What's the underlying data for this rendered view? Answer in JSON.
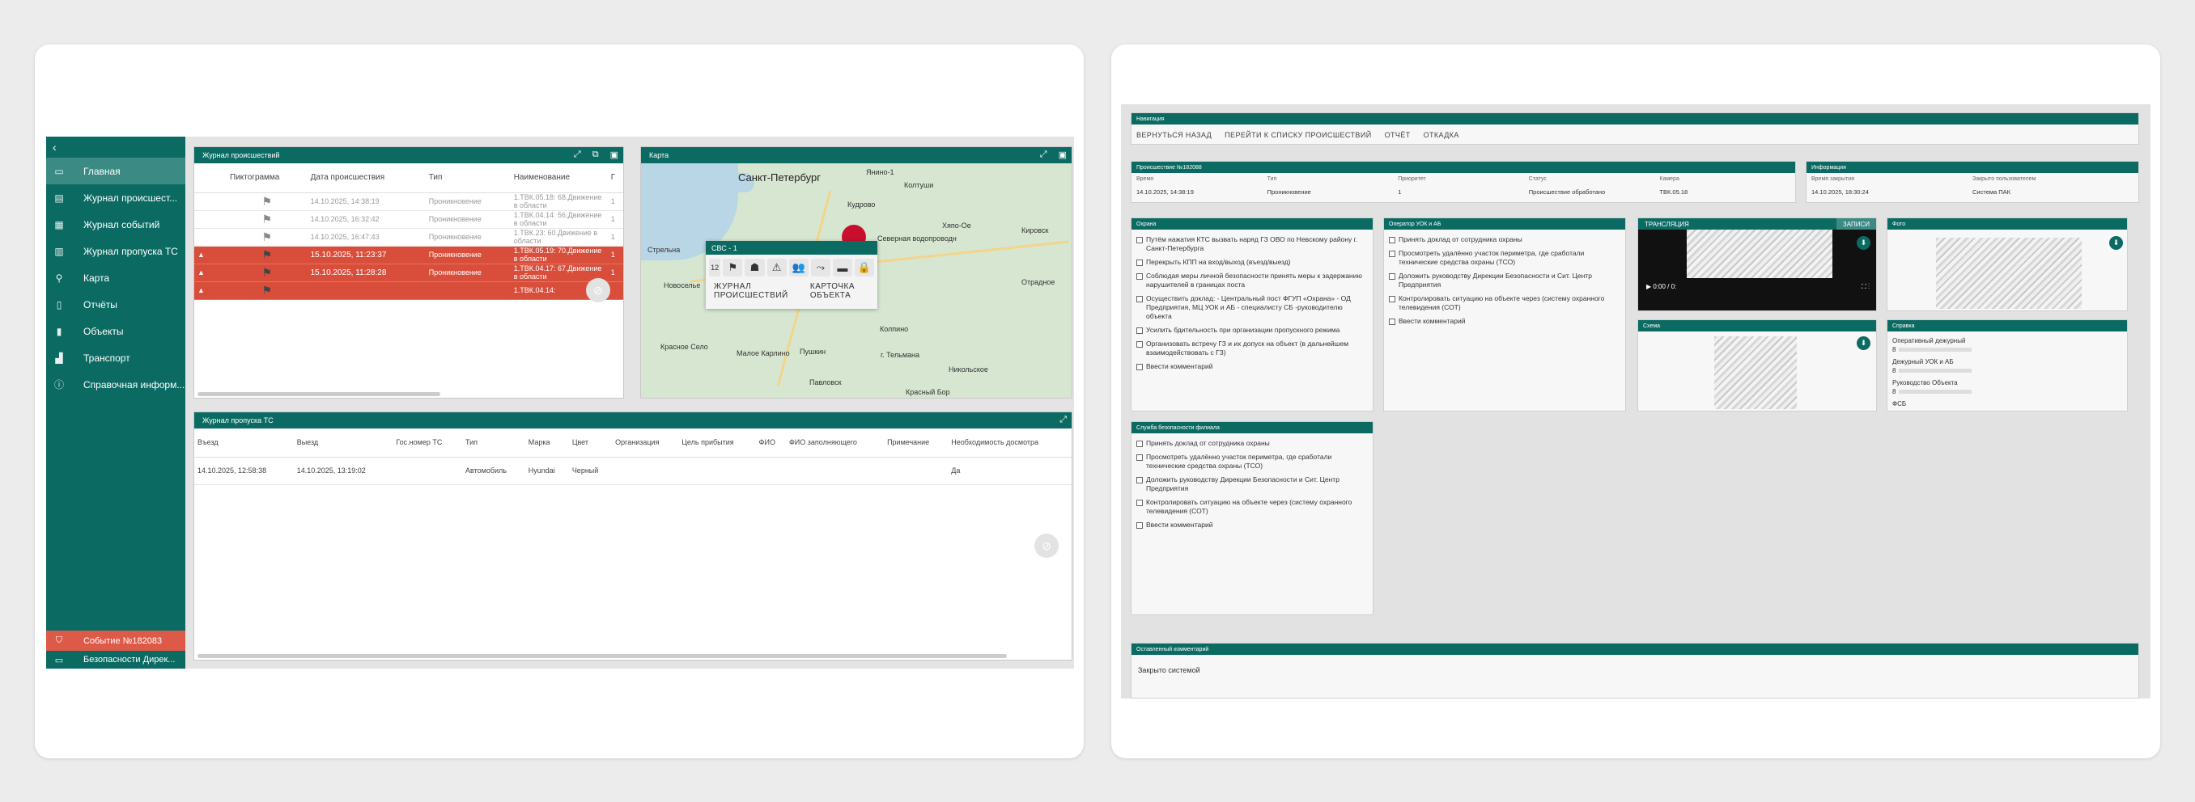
{
  "left": {
    "sidebar": {
      "back": "‹",
      "items": [
        {
          "label": "Главная",
          "icon": "monitor-icon",
          "glyph": "▭",
          "active": true
        },
        {
          "label": "Журнал происшест...",
          "icon": "journal-icon",
          "glyph": "▤"
        },
        {
          "label": "Журнал событий",
          "icon": "events-icon",
          "glyph": "▦"
        },
        {
          "label": "Журнал пропуска ТС",
          "icon": "car-pass-icon",
          "glyph": "▥"
        },
        {
          "label": "Карта",
          "icon": "map-pin-icon",
          "glyph": "⚲"
        },
        {
          "label": "Отчёты",
          "icon": "report-icon",
          "glyph": "▯"
        },
        {
          "label": "Объекты",
          "icon": "building-icon",
          "glyph": "▮"
        },
        {
          "label": "Транспорт",
          "icon": "chart-icon",
          "glyph": "▟"
        },
        {
          "label": "Справочная информ...",
          "icon": "info-icon",
          "glyph": "ⓘ"
        }
      ],
      "event": "Событие №182083",
      "sub": "Безопасности Дирек..."
    },
    "journal": {
      "title": "Журнал происшествий",
      "headers": [
        "",
        "Пиктограмма",
        "Дата происшествия",
        "Тип",
        "Наименование",
        "Г"
      ],
      "rows": [
        {
          "date": "14.10.2025, 14:38:19",
          "type": "Проникновение",
          "name": "1.ТВК.05.18: 68.Движение в области",
          "n": "1",
          "alarm": false
        },
        {
          "date": "14.10.2025, 16:32:42",
          "type": "Проникновение",
          "name": "1.ТВК.04.14: 56.Движение в области",
          "n": "1",
          "alarm": false
        },
        {
          "date": "14.10.2025, 16:47:43",
          "type": "Проникновение",
          "name": "1.ТВК.23: 60.Движение в области",
          "n": "1",
          "alarm": false
        },
        {
          "date": "15.10.2025, 11:23:37",
          "type": "Проникновение",
          "name": "1.ТВК.05.19: 70.Движение в области",
          "n": "1",
          "alarm": true
        },
        {
          "date": "15.10.2025, 11:28:28",
          "type": "Проникновение",
          "name": "1.ТВК.04.17: 67.Движение в области",
          "n": "1",
          "alarm": true
        },
        {
          "date": "",
          "type": "",
          "name": "1.ТВК.04.14:",
          "n": "",
          "alarm": true
        }
      ]
    },
    "map": {
      "title": "Карта",
      "cities": [
        {
          "t": "Санкт-Петербург",
          "big": true
        },
        {
          "t": "Янино-1"
        },
        {
          "t": "Колтуши"
        },
        {
          "t": "Кудрово"
        },
        {
          "t": "Хяпо-Ое"
        },
        {
          "t": "Кировск"
        },
        {
          "t": "Стрельна"
        },
        {
          "t": "Новоселье"
        },
        {
          "t": "Колпино"
        },
        {
          "t": "Красное Село"
        },
        {
          "t": "Пушкин"
        },
        {
          "t": "г. Тельмана"
        },
        {
          "t": "Никольское"
        },
        {
          "t": "Павловск"
        },
        {
          "t": "Малое Карлино"
        },
        {
          "t": "Северная водопроводн"
        },
        {
          "t": "Красный Бор"
        },
        {
          "t": "Отрадное"
        }
      ],
      "popup": {
        "title": "СВС - 1",
        "count": "12",
        "icons": [
          "barrier-icon",
          "person-running-icon",
          "fire-alarm-icon",
          "crowd-icon",
          "fall-icon",
          "vehicle-icon",
          "lock-icon"
        ],
        "link1": "ЖУРНАЛ ПРОИСШЕСТВИЙ",
        "link2": "КАРТОЧКА ОБЪЕКТА"
      }
    },
    "pass": {
      "title": "Журнал пропуска ТС",
      "headers": [
        "Въезд",
        "Выезд",
        "Гос.номер ТС",
        "Тип",
        "Марка",
        "Цвет",
        "Организация",
        "Цель прибытия",
        "ФИО",
        "ФИО заполняющего",
        "Примечание",
        "Необходимость досмотра"
      ],
      "rows": [
        [
          "14.10.2025, 12:58:38",
          "14.10.2025, 13:19:02",
          "",
          "Автомобиль",
          "Hyundai",
          "Черный",
          "",
          "",
          "",
          "",
          "",
          "Да"
        ]
      ]
    }
  },
  "right": {
    "nav": {
      "title": "Навигация",
      "buttons": [
        "ВЕРНУТЬСЯ НАЗАД",
        "ПЕРЕЙТИ К СПИСКУ ПРОИСШЕСТВИЙ",
        "ОТЧЁТ",
        "ОТКАДКА"
      ]
    },
    "incident": {
      "title": "Происшествие №182088",
      "labels": [
        "Время",
        "Тип",
        "Приоритет",
        "Статус",
        "Камера"
      ],
      "values": [
        "14.10.2025, 14:38:19",
        "Проникновение",
        "1",
        "Происшествие обработано",
        "ТВК.05.18"
      ]
    },
    "info": {
      "title": "Информация",
      "labels": [
        "Время закрытия",
        "Закрыто пользователем"
      ],
      "values": [
        "14.10.2025, 18:30:24",
        "Система ПАК"
      ]
    },
    "guard": {
      "title": "Охрана",
      "items": [
        "Путём нажатия КТС вызвать наряд ГЗ ОВО по Невскому району г. Санкт-Петербурга",
        "Перекрыть КПП на вход/выход (въезд/выезд)",
        "Соблюдая меры личной безопасности принять меры к задержанию нарушителей в границах поста",
        "Осуществить доклад: - Центральный пост ФГУП «Охрана» - ОД Предприятия, МЦ УОК и АБ - специалисту СБ -руководителю объекта",
        "Усилить бдительность при организации пропускного режима",
        "Организовать встречу ГЗ и их допуск на объект (в дальнейшем взаимодействовать с ГЗ)",
        "Ввести комментарий"
      ]
    },
    "operator": {
      "title": "Оператор УОК и АБ",
      "items": [
        "Принять доклад от сотрудника охраны",
        "Просмотреть удалённо участок периметра, где сработали технические средства охраны (ТСО)",
        "Доложить руководству Дирекции Безопасности и Сит. Центр Предприятия",
        "Контролировать ситуацию на объекте через (систему охранного телевидения (СОТ)",
        "Ввести комментарий"
      ]
    },
    "broadcast": {
      "tab1": "ТРАНСЛЯЦИЯ",
      "tab2": "ЗАПИСИ",
      "time": "0:00 / 0:"
    },
    "photo": {
      "title": "Фото"
    },
    "scheme": {
      "title": "Схема"
    },
    "ref": {
      "title": "Справка",
      "items": [
        "Оперативный дежурный",
        "Дежурный УОК и АБ",
        "Руководство Объекта",
        "ФСБ"
      ],
      "prefix": [
        "8",
        "8",
        "8",
        ""
      ]
    },
    "branch": {
      "title": "Служба безопасности филиала",
      "items": [
        "Принять доклад от сотрудника охраны",
        "Просмотреть удалённо участок периметра, где сработали технические средства охраны (ТСО)",
        "Доложить руководству Дирекции Безопасности и Сит. Центр Предприятия",
        "Контролировать ситуацию на объекте через (систему охранного телевидения (СОТ)",
        "Ввести комментарий"
      ]
    },
    "comment": {
      "title": "Оставленный комментарий",
      "text": "Закрыто системой"
    }
  },
  "colors": {
    "accent": "#0b6b63",
    "alarm": "#d94e3b",
    "active": "#3b8a83"
  }
}
